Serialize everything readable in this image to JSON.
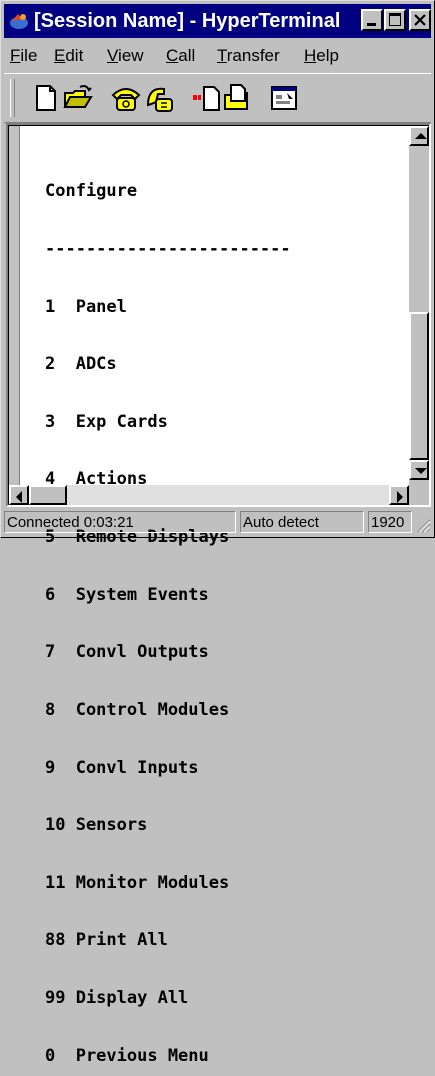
{
  "window": {
    "title": "[Session Name] - HyperTerminal"
  },
  "menu": [
    {
      "pre": "",
      "u": "F",
      "post": "ile"
    },
    {
      "pre": "",
      "u": "E",
      "post": "dit"
    },
    {
      "pre": "",
      "u": "V",
      "post": "iew"
    },
    {
      "pre": "",
      "u": "C",
      "post": "all"
    },
    {
      "pre": "",
      "u": "T",
      "post": "ransfer"
    },
    {
      "pre": "",
      "u": "H",
      "post": "elp"
    }
  ],
  "toolbar": {
    "icons": [
      "new-document-icon",
      "open-folder-icon",
      "connect-phone-icon",
      "disconnect-phone-icon",
      "send-file-icon",
      "receive-file-icon",
      "properties-icon"
    ]
  },
  "terminal": {
    "lines": [
      "Configure",
      "------------------------",
      "1  Panel",
      "2  ADCs",
      "3  Exp Cards",
      "4  Actions",
      "5  Remote Displays",
      "6  System Events",
      "7  Convl Outputs",
      "8  Control Modules",
      "9  Convl Inputs",
      "10 Sensors",
      "11 Monitor Modules",
      "88 Print All",
      "99 Display All",
      "0  Previous Menu"
    ]
  },
  "status": {
    "connection": "Connected 0:03:21",
    "detect": "Auto detect",
    "baud": "1920"
  },
  "colors": {
    "titlebar": "#000080",
    "face": "#c0c0c0",
    "terminal_bg": "#ffffff"
  }
}
